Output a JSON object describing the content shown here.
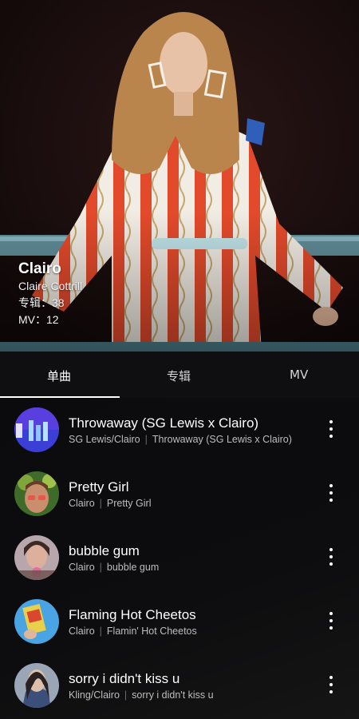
{
  "artist": {
    "name": "Clairo",
    "real_name": "Claire Cottrill",
    "albums_label": "专辑：",
    "albums_count": "38",
    "mv_label": "MV：",
    "mv_count": "12"
  },
  "tabs": [
    {
      "label": "单曲",
      "active": true
    },
    {
      "label": "专辑",
      "active": false
    },
    {
      "label": "MV",
      "active": false
    }
  ],
  "songs": [
    {
      "title": "Throwaway (SG Lewis x Clairo)",
      "artist": "SG Lewis/Clairo",
      "album": "Throwaway (SG Lewis x Clairo)"
    },
    {
      "title": "Pretty Girl",
      "artist": "Clairo",
      "album": "Pretty Girl"
    },
    {
      "title": "bubble gum",
      "artist": "Clairo",
      "album": "bubble gum"
    },
    {
      "title": "Flaming Hot Cheetos",
      "artist": "Clairo",
      "album": "Flamin' Hot Cheetos"
    },
    {
      "title": "sorry i didn't kiss u",
      "artist": "Kling/Clairo",
      "album": "sorry i didn't kiss u"
    }
  ],
  "separator": "|",
  "icons": {
    "more": "more-vertical-icon"
  },
  "colors": {
    "background": "#0e0e10",
    "accent": "#ffffff",
    "secondary_text": "#bdbdbd"
  }
}
